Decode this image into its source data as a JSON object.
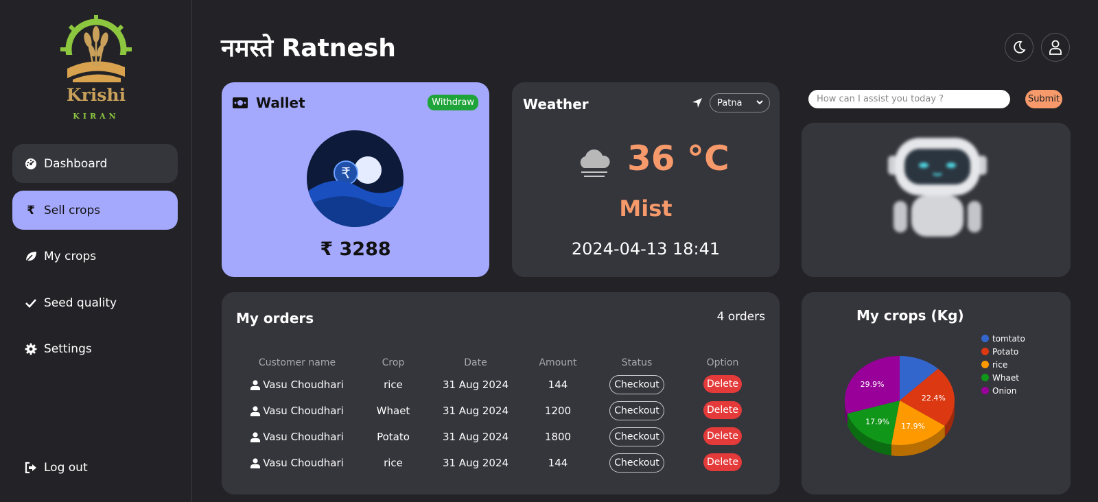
{
  "brand": {
    "name": "Krishi",
    "sub": "KIRAN"
  },
  "sidebar": {
    "items": [
      {
        "label": "Dashboard",
        "icon": "gauge-icon"
      },
      {
        "label": "Sell crops",
        "icon": "rupee-icon"
      },
      {
        "label": "My crops",
        "icon": "leaf-icon"
      },
      {
        "label": "Seed quality",
        "icon": "check-icon"
      },
      {
        "label": "Settings",
        "icon": "gear-icon"
      }
    ],
    "logout": "Log out"
  },
  "header": {
    "greeting": "नमस्ते Ratnesh"
  },
  "wallet": {
    "title": "Wallet",
    "withdraw": "Withdraw",
    "amount": "₹ 3288"
  },
  "weather": {
    "title": "Weather",
    "city": "Patna",
    "temp": "36 °C",
    "condition": "Mist",
    "datetime": "2024-04-13 18:41"
  },
  "assistant": {
    "placeholder": "How can I assist you today ?",
    "submit": "Submit"
  },
  "orders": {
    "title": "My orders",
    "count": "4 orders",
    "columns": [
      "Customer name",
      "Crop",
      "Date",
      "Amount",
      "Status",
      "Option"
    ],
    "rows": [
      {
        "name": "Vasu Choudhari",
        "crop": "rice",
        "date": "31 Aug 2024",
        "amount": "144",
        "status": "Checkout",
        "option": "Delete"
      },
      {
        "name": "Vasu Choudhari",
        "crop": "Whaet",
        "date": "31 Aug 2024",
        "amount": "1200",
        "status": "Checkout",
        "option": "Delete"
      },
      {
        "name": "Vasu Choudhari",
        "crop": "Potato",
        "date": "31 Aug 2024",
        "amount": "1800",
        "status": "Checkout",
        "option": "Delete"
      },
      {
        "name": "Vasu Choudhari",
        "crop": "rice",
        "date": "31 Aug 2024",
        "amount": "144",
        "status": "Checkout",
        "option": "Delete"
      }
    ]
  },
  "chart_data": {
    "type": "pie",
    "title": "My crops (Kg)",
    "legend_position": "right",
    "categories": [
      "tomtato",
      "Potato",
      "rice",
      "Whaet",
      "Onion"
    ],
    "colors": [
      "#3366cc",
      "#dc3912",
      "#ff9900",
      "#109618",
      "#990099"
    ],
    "values": [
      12.4,
      22.4,
      17.9,
      17.9,
      29.9
    ],
    "labels": [
      "",
      "22.4%",
      "17.9%",
      "17.9%",
      "29.9%"
    ]
  }
}
